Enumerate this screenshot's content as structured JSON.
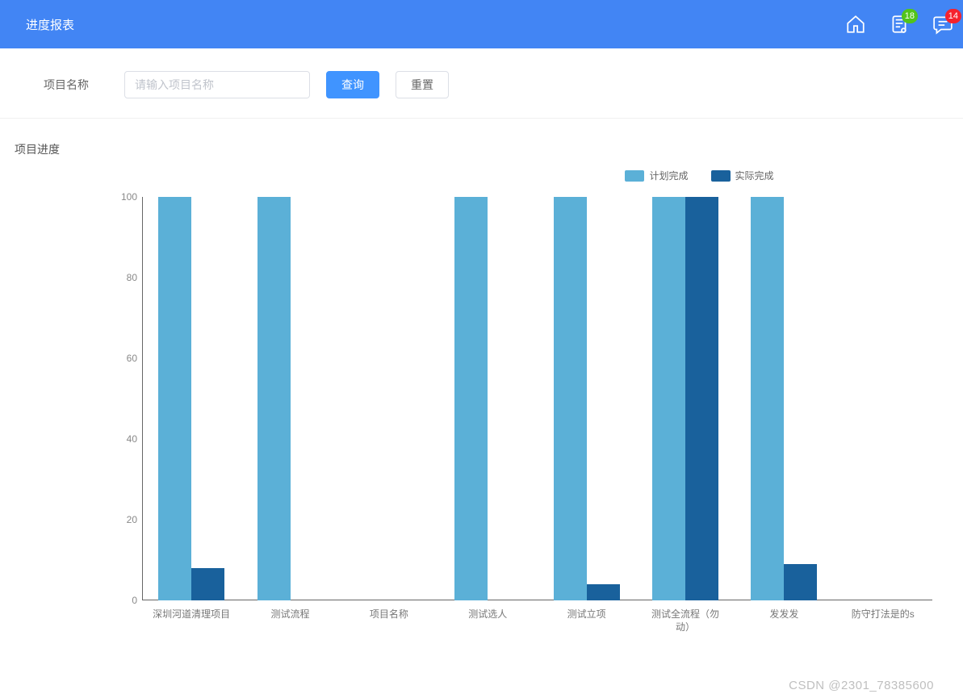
{
  "header": {
    "title": "进度报表",
    "badges": {
      "doc": "18",
      "chat": "14"
    }
  },
  "search": {
    "label": "项目名称",
    "placeholder": "请输入项目名称",
    "query_btn": "查询",
    "reset_btn": "重置"
  },
  "section_title": "项目进度",
  "legend": {
    "plan": "计划完成",
    "actual": "实际完成"
  },
  "colors": {
    "plan": "#5bb0d7",
    "actual": "#19619c"
  },
  "watermark": "CSDN @2301_78385600",
  "chart_data": {
    "type": "bar",
    "categories": [
      "深圳河道清理项目",
      "测试流程",
      "项目名称",
      "测试选人",
      "测试立项",
      "测试全流程（勿动）",
      "发发发",
      "防守打法是的s"
    ],
    "series": [
      {
        "name": "计划完成",
        "values": [
          100,
          100,
          0,
          100,
          100,
          100,
          100,
          0
        ]
      },
      {
        "name": "实际完成",
        "values": [
          8,
          0,
          0,
          0,
          4,
          100,
          9,
          0
        ]
      }
    ],
    "y_ticks": [
      0,
      20,
      40,
      60,
      80,
      100
    ],
    "ylim": [
      0,
      100
    ],
    "xlabel": "",
    "ylabel": ""
  }
}
